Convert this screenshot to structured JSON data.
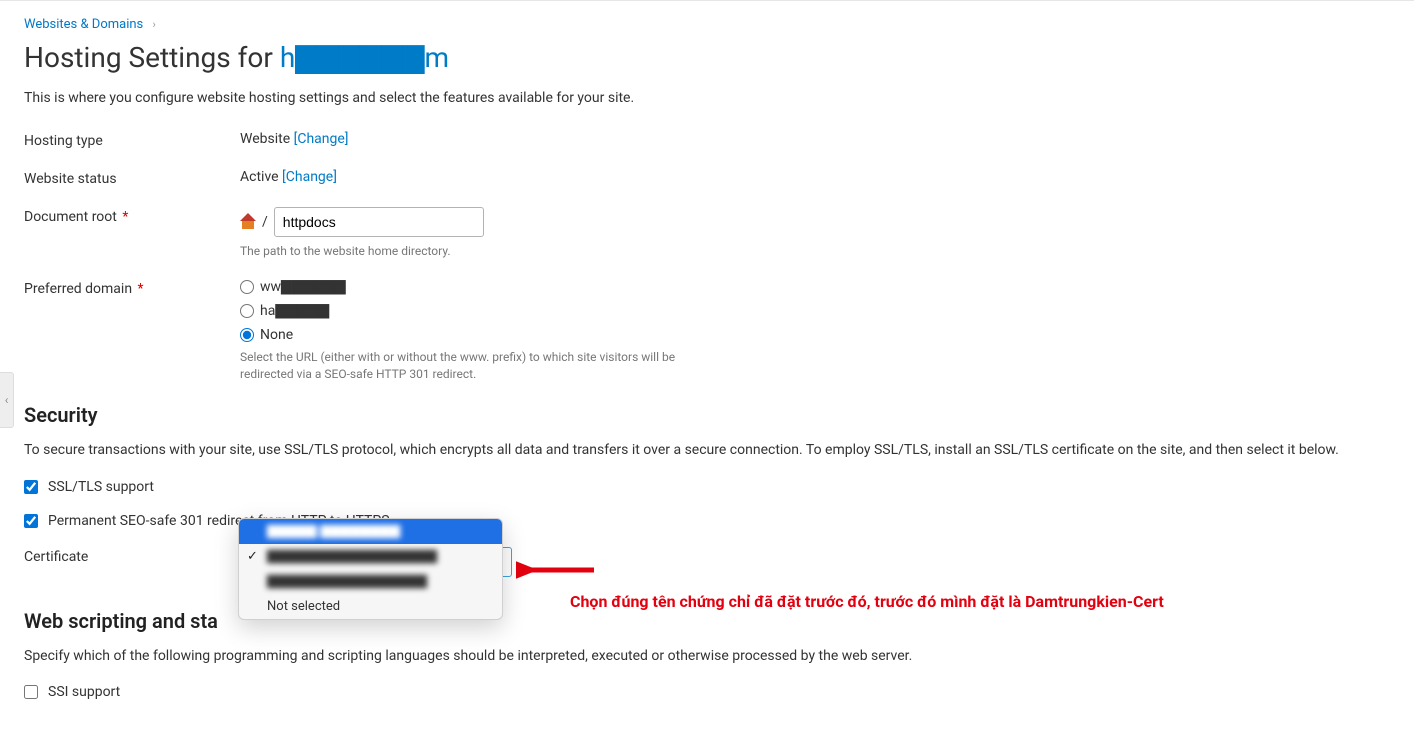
{
  "breadcrumb": {
    "parent": "Websites & Domains"
  },
  "title": {
    "prefix": "Hosting Settings for ",
    "domain_display": "h▇▇▇▇▇▇m"
  },
  "page_description": "This is where you configure website hosting settings and select the features available for your site.",
  "hosting_type": {
    "label": "Hosting type",
    "value": "Website",
    "change": "[Change]"
  },
  "website_status": {
    "label": "Website status",
    "value": "Active",
    "change": "[Change]"
  },
  "document_root": {
    "label": "Document root",
    "value": "httpdocs",
    "hint": "The path to the website home directory."
  },
  "preferred_domain": {
    "label": "Preferred domain",
    "options": {
      "www": "ww▇▇▇▇▇▇",
      "nowww": "ha▇▇▇▇▇",
      "none": "None"
    },
    "selected": "none",
    "hint": "Select the URL (either with or without the www. prefix) to which site visitors will be redirected via a SEO-safe HTTP 301 redirect."
  },
  "security": {
    "heading": "Security",
    "desc": "To secure transactions with your site, use SSL/TLS protocol, which encrypts all data and transfers it over a secure connection. To employ SSL/TLS, install an SSL/TLS certificate on the site, and then select it below.",
    "ssl_support": {
      "label": "SSL/TLS support",
      "checked": true
    },
    "redirect301": {
      "label": "Permanent SEO-safe 301 redirect from HTTP to HTTPS",
      "checked": true
    },
    "certificate": {
      "label": "Certificate",
      "dropdown": {
        "options": [
          {
            "text": "▇▇▇▇▇  ▇▇▇▇▇▇▇▇",
            "highlighted": true,
            "checked": false
          },
          {
            "text": "▇▇▇▇▇▇▇▇▇▇▇▇▇▇▇▇▇",
            "highlighted": false,
            "checked": true
          },
          {
            "text": "▇▇▇▇▇▇▇▇▇▇▇▇▇▇▇▇",
            "highlighted": false,
            "checked": false
          },
          {
            "text": "Not selected",
            "highlighted": false,
            "checked": false
          }
        ]
      }
    }
  },
  "scripting": {
    "heading": "Web scripting and sta",
    "desc": "Specify which of the following programming and scripting languages should be interpreted, executed or otherwise processed by the web server.",
    "ssi": {
      "label": "SSI support",
      "checked": false
    }
  },
  "annotation": {
    "text": "Chọn đúng tên chứng chỉ đã đặt trước đó, trước đó mình đặt là Damtrungkien-Cert"
  }
}
